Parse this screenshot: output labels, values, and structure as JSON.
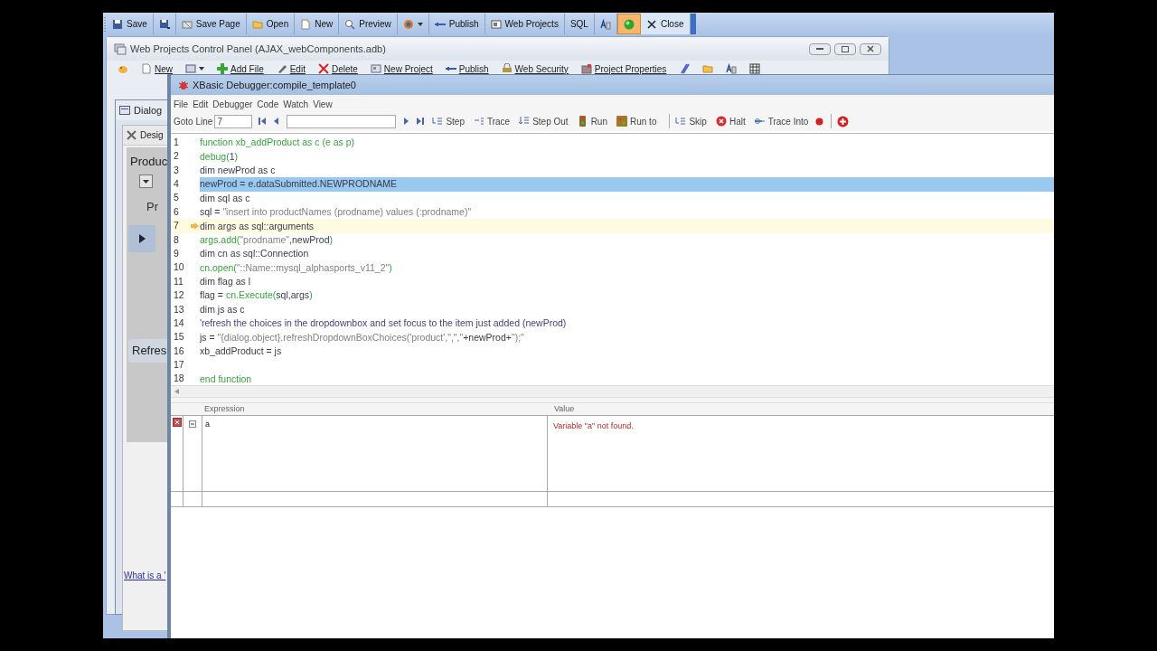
{
  "main_toolbar": {
    "items": [
      {
        "label": "Save",
        "on": false
      },
      {
        "on": false
      },
      {
        "label": "Save Page",
        "on": false
      },
      {
        "label": "Open",
        "on": false
      },
      {
        "label": "New",
        "on": false
      },
      {
        "label": "Preview",
        "on": false
      },
      {
        "on": false,
        "dropdown": true
      },
      {
        "label": "Publish",
        "on": false
      },
      {
        "label": "Web Projects",
        "on": false
      },
      {
        "label": "SQL",
        "on": false
      },
      {
        "on": false
      },
      {
        "on": true
      },
      {
        "label": "Close",
        "on": false
      }
    ]
  },
  "control_panel": {
    "title": "Web Projects Control Panel (AJAX_webComponents.adb)",
    "toolbar": [
      {
        "kind": "icon"
      },
      {
        "kind": "text",
        "label": "New"
      },
      {
        "kind": "icon",
        "dropdown": true
      },
      {
        "kind": "text",
        "label": "Add File"
      },
      {
        "kind": "text",
        "label": "Edit"
      },
      {
        "kind": "text",
        "label": "Delete"
      },
      {
        "kind": "text",
        "label": "New Project"
      },
      {
        "kind": "text",
        "label": "Publish"
      },
      {
        "kind": "text",
        "label": "Web Security"
      },
      {
        "kind": "text",
        "label": "Project Properties"
      },
      {
        "kind": "icon"
      },
      {
        "kind": "icon"
      },
      {
        "kind": "icon"
      },
      {
        "kind": "icon"
      }
    ]
  },
  "dialog": {
    "title": "Dialog",
    "tab": "Desig",
    "label_1": "Produc",
    "label_2": "Pr",
    "button": "Refres",
    "link": "What is a '"
  },
  "debugger": {
    "title": "XBasic Debugger:compile_template0",
    "menu": [
      "File",
      "Edit",
      "Debugger",
      "Code",
      "Watch",
      "View"
    ],
    "goto_label": "Goto Line",
    "goto_value": "7",
    "tools": [
      {
        "label": "Step"
      },
      {
        "label": "Trace"
      },
      {
        "label": "Step Out"
      },
      {
        "label": "Run"
      },
      {
        "label": "Run to"
      },
      {
        "label": "Skip"
      },
      {
        "label": "Halt"
      },
      {
        "label": "Trace Into"
      }
    ],
    "code": [
      {
        "number": "1",
        "selected": false,
        "current": false,
        "segments": [
          {
            "kind": "keyword",
            "text": "function xb_addProduct as c (e as p)"
          }
        ]
      },
      {
        "number": "2",
        "selected": false,
        "current": false,
        "segments": [
          {
            "kind": "keyword",
            "text": "debug("
          },
          {
            "kind": "plain",
            "text": "1"
          },
          {
            "kind": "keyword",
            "text": ")"
          }
        ]
      },
      {
        "number": "3",
        "selected": false,
        "current": false,
        "segments": [
          {
            "kind": "plain",
            "text": "dim newProd as c"
          }
        ]
      },
      {
        "number": "4",
        "selected": true,
        "current": false,
        "segments": [
          {
            "kind": "plain",
            "text": "newProd = e.dataSubmitted.NEWPRODNAME"
          }
        ]
      },
      {
        "number": "5",
        "selected": false,
        "current": false,
        "segments": [
          {
            "kind": "plain",
            "text": "dim sql as c"
          }
        ]
      },
      {
        "number": "6",
        "selected": false,
        "current": false,
        "segments": [
          {
            "kind": "plain",
            "text": "sql = "
          },
          {
            "kind": "string",
            "text": "\"insert into productNames (prodname) values (:prodname)\""
          }
        ]
      },
      {
        "number": "7",
        "selected": false,
        "current": true,
        "segments": [
          {
            "kind": "plain",
            "text": "dim args as sql::arguments"
          }
        ]
      },
      {
        "number": "8",
        "selected": false,
        "current": false,
        "segments": [
          {
            "kind": "keyword",
            "text": "args.add("
          },
          {
            "kind": "string",
            "text": "\"prodname\""
          },
          {
            "kind": "plain",
            "text": ",newProd"
          },
          {
            "kind": "keyword",
            "text": ")"
          }
        ]
      },
      {
        "number": "9",
        "selected": false,
        "current": false,
        "segments": [
          {
            "kind": "plain",
            "text": "dim cn as sql::Connection"
          }
        ]
      },
      {
        "number": "10",
        "selected": false,
        "current": false,
        "segments": [
          {
            "kind": "keyword",
            "text": "cn.open("
          },
          {
            "kind": "string",
            "text": "\"::Name::mysql_alphasports_v11_2\""
          },
          {
            "kind": "keyword",
            "text": ")"
          }
        ]
      },
      {
        "number": "11",
        "selected": false,
        "current": false,
        "segments": [
          {
            "kind": "plain",
            "text": "dim flag as l"
          }
        ]
      },
      {
        "number": "12",
        "selected": false,
        "current": false,
        "segments": [
          {
            "kind": "plain",
            "text": "flag = "
          },
          {
            "kind": "keyword",
            "text": "cn.Execute("
          },
          {
            "kind": "plain",
            "text": "sql,args"
          },
          {
            "kind": "keyword",
            "text": ")"
          }
        ]
      },
      {
        "number": "13",
        "selected": false,
        "current": false,
        "segments": [
          {
            "kind": "plain",
            "text": "dim js as c"
          }
        ]
      },
      {
        "number": "14",
        "selected": false,
        "current": false,
        "segments": [
          {
            "kind": "comment",
            "text": "'refresh the choices in the dropdownbox and set focus to the item just added (newProd)"
          }
        ]
      },
      {
        "number": "15",
        "selected": false,
        "current": false,
        "segments": [
          {
            "kind": "plain",
            "text": "js = "
          },
          {
            "kind": "string",
            "text": "\"{dialog.object}.refreshDropdownBoxChoices('product',\",\",\""
          },
          {
            "kind": "plain",
            "text": "+newProd+"
          },
          {
            "kind": "string",
            "text": "\");\""
          }
        ]
      },
      {
        "number": "16",
        "selected": false,
        "current": false,
        "segments": [
          {
            "kind": "plain",
            "text": "xb_addProduct = js"
          }
        ]
      },
      {
        "number": "17",
        "selected": false,
        "current": false
      },
      {
        "number": "18",
        "selected": false,
        "current": false,
        "segments": [
          {
            "kind": "keyword",
            "text": "end function"
          }
        ]
      }
    ],
    "watch": {
      "columns": [
        "Expression",
        "Value"
      ],
      "rows": [
        {
          "expression": "a",
          "value": "Variable \"a\" not found.",
          "error": true,
          "expanded": true
        }
      ]
    }
  }
}
